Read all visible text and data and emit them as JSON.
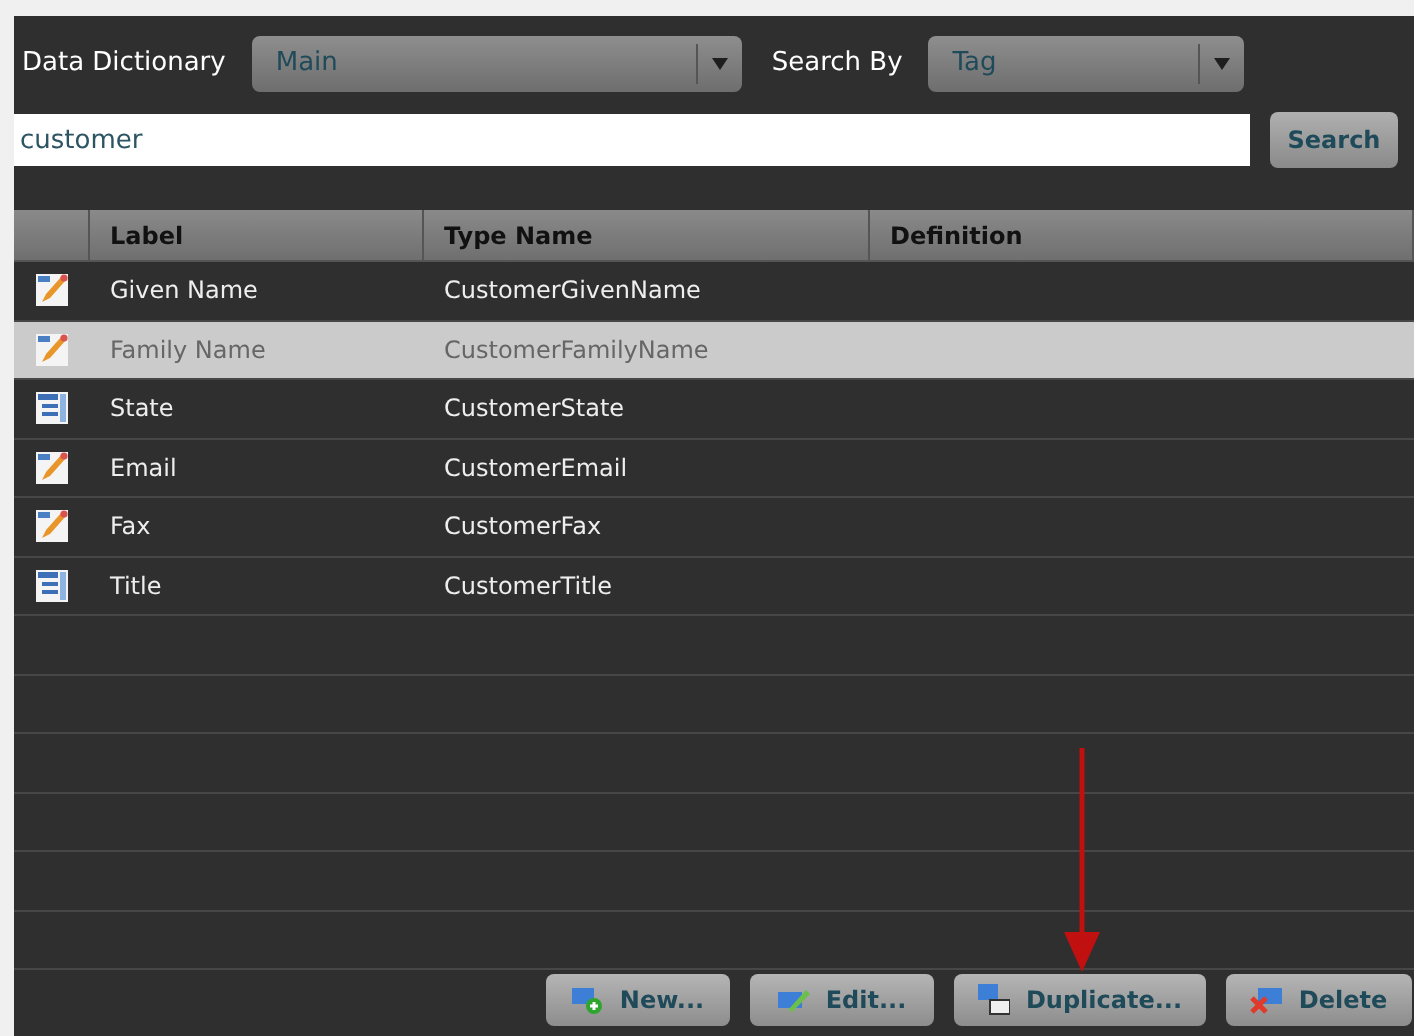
{
  "toolbar": {
    "dictionary_label": "Data Dictionary",
    "dictionary": "Main",
    "search_by_label": "Search By",
    "search_by": "Tag"
  },
  "search": {
    "value": "customer",
    "button": "Search"
  },
  "table": {
    "columns": [
      "Label",
      "Type Name",
      "Definition"
    ],
    "rows": [
      {
        "kind": "text",
        "label": "Given Name",
        "type_name": "CustomerGivenName",
        "selected": false
      },
      {
        "kind": "text",
        "label": "Family Name",
        "type_name": "CustomerFamilyName",
        "selected": true
      },
      {
        "kind": "list",
        "label": "State",
        "type_name": "CustomerState",
        "selected": false
      },
      {
        "kind": "text",
        "label": "Email",
        "type_name": "CustomerEmail",
        "selected": false
      },
      {
        "kind": "text",
        "label": "Fax",
        "type_name": "CustomerFax",
        "selected": false
      },
      {
        "kind": "list",
        "label": "Title",
        "type_name": "CustomerTitle",
        "selected": false
      }
    ]
  },
  "buttons": [
    {
      "kind": "new",
      "label": "New..."
    },
    {
      "kind": "edit",
      "label": "Edit..."
    },
    {
      "kind": "duplicate",
      "label": "Duplicate..."
    },
    {
      "kind": "delete",
      "label": "Delete"
    }
  ]
}
